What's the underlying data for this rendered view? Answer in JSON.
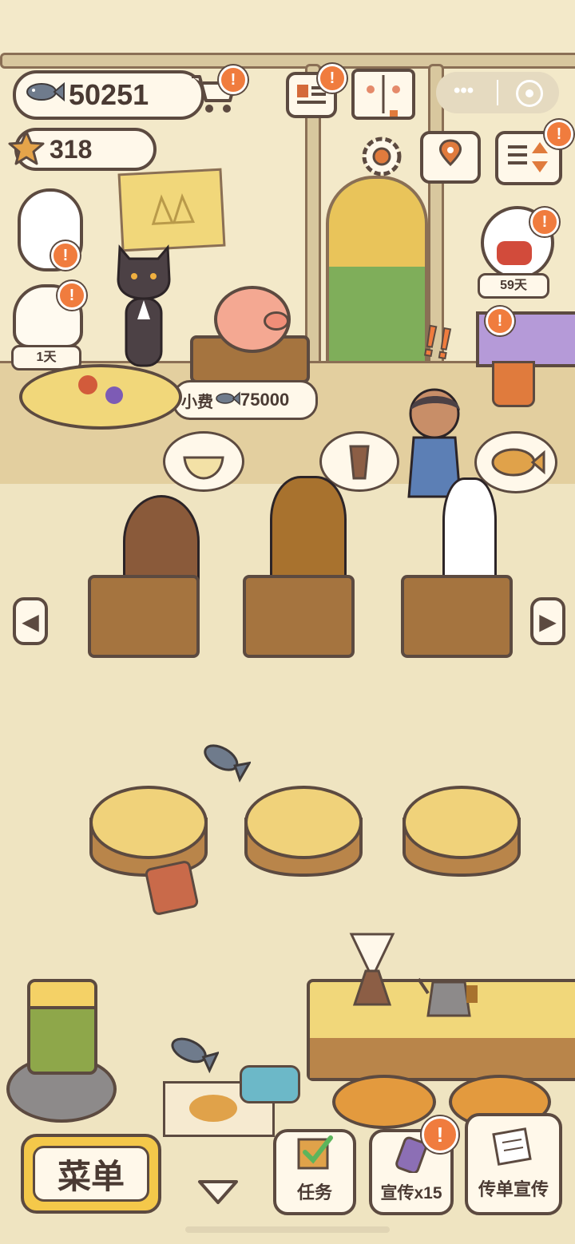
{
  "currency": {
    "fish_amount": "50251",
    "star_amount": "318"
  },
  "status": {
    "lucky_cat_days": "1天",
    "guest_days": "59天"
  },
  "tip": {
    "label": "小费",
    "amount": "75000"
  },
  "orders": [
    "rice-bowl-icon",
    "drink-cup-icon",
    "taiyaki-icon"
  ],
  "bottom_bar": {
    "menu_label": "菜单",
    "tasks_label": "任务",
    "promote_label": "宣传x15",
    "flyer_label": "传单宣传"
  },
  "alert_mark": "!",
  "colors": {
    "alert": "#f07c3e",
    "outline": "#5c4a40",
    "menu_button": "#f4c84a"
  }
}
